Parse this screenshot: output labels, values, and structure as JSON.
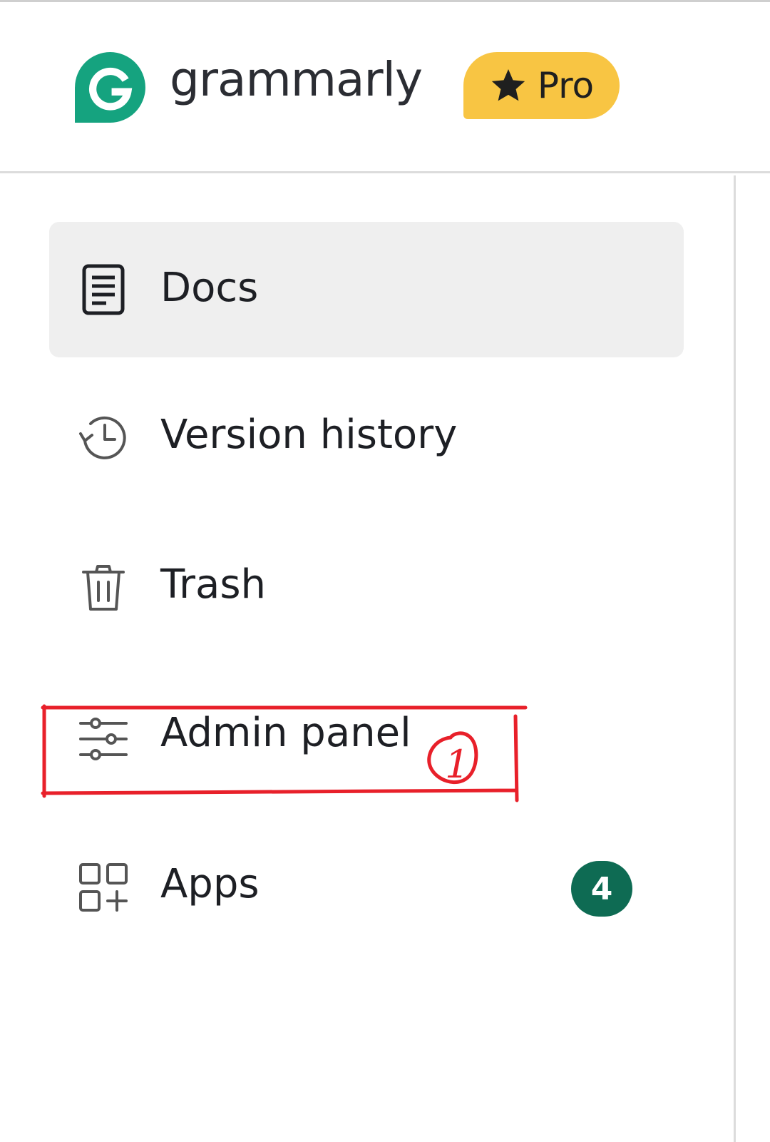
{
  "brand": {
    "name": "grammarly",
    "logo_icon": "grammarly-g-logo",
    "logo_color": "#15a37f",
    "pro_label": "Pro",
    "pro_icon": "star-icon",
    "pro_color": "#f8c543"
  },
  "sidebar": {
    "items": [
      {
        "label": "Docs",
        "icon": "document-icon",
        "active": true
      },
      {
        "label": "Version history",
        "icon": "history-icon",
        "active": false
      },
      {
        "label": "Trash",
        "icon": "trash-icon",
        "active": false
      },
      {
        "label": "Admin panel",
        "icon": "sliders-icon",
        "active": false
      },
      {
        "label": "Apps",
        "icon": "apps-add-icon",
        "active": false,
        "badge": "4"
      }
    ]
  },
  "annotation": {
    "marker": "1",
    "color": "#e8202a"
  },
  "colors": {
    "accent": "#0e6b53",
    "active_bg": "#efefef",
    "text": "#1d1f24"
  }
}
